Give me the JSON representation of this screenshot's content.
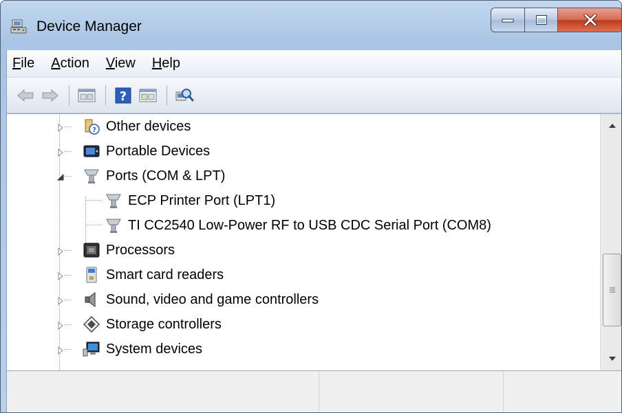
{
  "window": {
    "title": "Device Manager",
    "colors": {
      "close_button": "#c0391f",
      "frame": "#a9c4e4"
    }
  },
  "menu": [
    {
      "label": "File",
      "mnemonic": "F",
      "rest": "ile"
    },
    {
      "label": "Action",
      "mnemonic": "A",
      "rest": "ction"
    },
    {
      "label": "View",
      "mnemonic": "V",
      "rest": "iew"
    },
    {
      "label": "Help",
      "mnemonic": "H",
      "rest": "elp"
    }
  ],
  "toolbar": {
    "icons": [
      "back-arrow-icon",
      "forward-arrow-icon",
      "show-hide-console-tree-icon",
      "help-icon",
      "show-action-pane-icon",
      "scan-hardware-changes-icon"
    ]
  },
  "tree": {
    "items": [
      {
        "label": "Other devices",
        "icon": "unknown-device-icon",
        "expanded": false,
        "level": 1
      },
      {
        "label": "Portable Devices",
        "icon": "portable-device-icon",
        "expanded": false,
        "level": 1
      },
      {
        "label": "Ports (COM & LPT)",
        "icon": "port-connector-icon",
        "expanded": true,
        "level": 1
      },
      {
        "label": "ECP Printer Port (LPT1)",
        "icon": "port-connector-icon",
        "level": 2
      },
      {
        "label": "TI CC2540 Low-Power RF to USB CDC Serial Port (COM8)",
        "icon": "port-connector-icon",
        "level": 2
      },
      {
        "label": "Processors",
        "icon": "processor-icon",
        "expanded": false,
        "level": 1
      },
      {
        "label": "Smart card readers",
        "icon": "smart-card-reader-icon",
        "expanded": false,
        "level": 1
      },
      {
        "label": "Sound, video and game controllers",
        "icon": "speaker-icon",
        "expanded": false,
        "level": 1
      },
      {
        "label": "Storage controllers",
        "icon": "storage-controller-icon",
        "expanded": false,
        "level": 1
      },
      {
        "label": "System devices",
        "icon": "system-devices-icon",
        "expanded": false,
        "level": 1
      }
    ]
  },
  "scrollbar": {
    "position": 0.85
  }
}
